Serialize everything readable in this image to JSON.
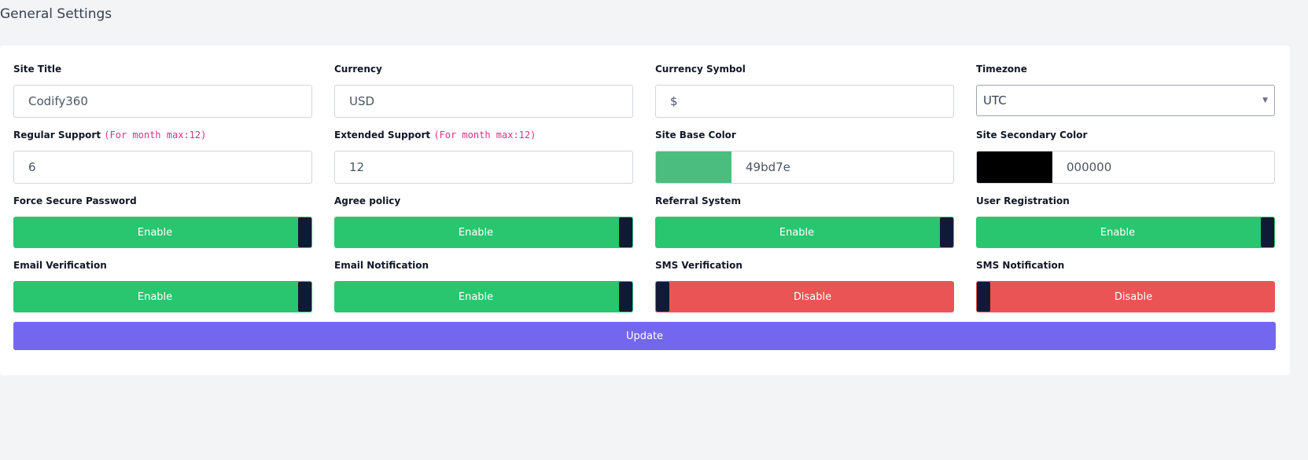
{
  "page": {
    "title": "General Settings"
  },
  "fields": {
    "site_title": {
      "label": "Site Title",
      "value": "Codify360"
    },
    "currency": {
      "label": "Currency",
      "value": "USD"
    },
    "currency_symbol": {
      "label": "Currency Symbol",
      "value": "$"
    },
    "timezone": {
      "label": "Timezone",
      "value": "UTC"
    },
    "regular_support": {
      "label": "Regular Support",
      "hint": "(For month max:12)",
      "value": "6"
    },
    "extended_support": {
      "label": "Extended Support",
      "hint": "(For month max:12)",
      "value": "12"
    },
    "site_base_color": {
      "label": "Site Base Color",
      "value": "49bd7e",
      "swatch": "#4bbd7e"
    },
    "site_secondary_color": {
      "label": "Site Secondary Color",
      "value": "000000",
      "swatch": "#000000"
    }
  },
  "toggles": {
    "force_secure_password": {
      "label": "Force Secure Password",
      "state": "Enable"
    },
    "agree_policy": {
      "label": "Agree policy",
      "state": "Enable"
    },
    "referral_system": {
      "label": "Referral System",
      "state": "Enable"
    },
    "user_registration": {
      "label": "User Registration",
      "state": "Enable"
    },
    "email_verification": {
      "label": "Email Verification",
      "state": "Enable"
    },
    "email_notification": {
      "label": "Email Notification",
      "state": "Enable"
    },
    "sms_verification": {
      "label": "SMS Verification",
      "state": "Disable"
    },
    "sms_notification": {
      "label": "SMS Notification",
      "state": "Disable"
    }
  },
  "actions": {
    "update_label": "Update"
  },
  "colors": {
    "enable": "#2ac56f",
    "disable": "#ea5455",
    "primary": "#7367f0",
    "knob": "#0f1a36"
  }
}
